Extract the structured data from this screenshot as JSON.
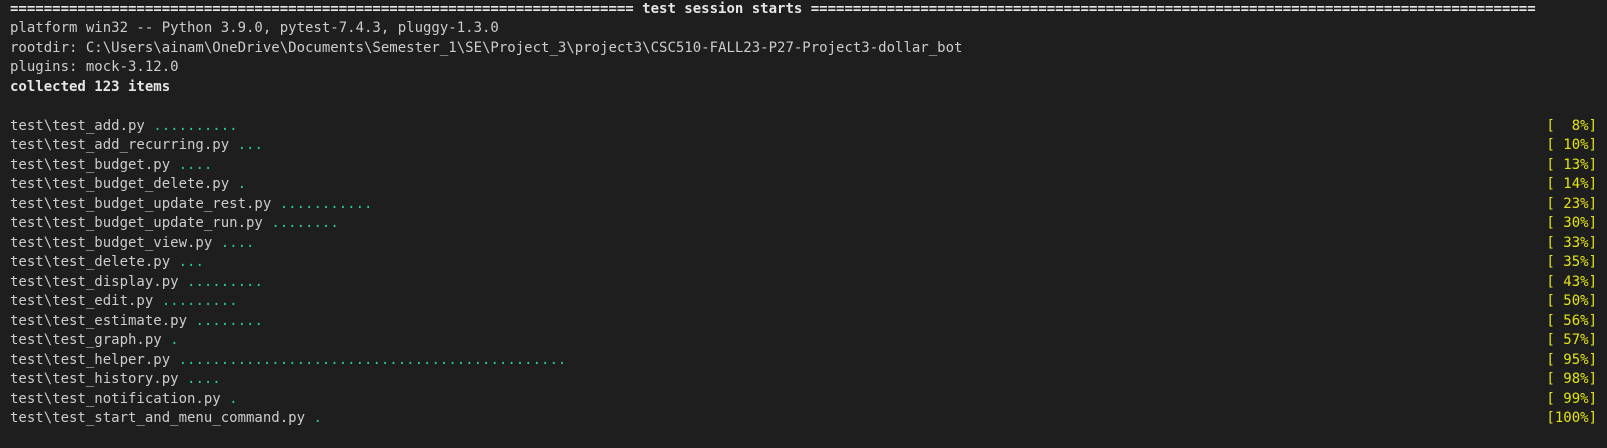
{
  "header": {
    "separator_left": "==========================================================================",
    "title": " test session starts ",
    "separator_right": "======================================================================================"
  },
  "session_info": {
    "platform": "platform win32 -- Python 3.9.0, pytest-7.4.3, pluggy-1.3.0",
    "rootdir": "rootdir: C:\\Users\\ainam\\OneDrive\\Documents\\Semester_1\\SE\\Project_3\\project3\\CSC510-FALL23-P27-Project3-dollar_bot",
    "plugins": "plugins: mock-3.12.0",
    "collected": "collected 123 items"
  },
  "tests": [
    {
      "file": "test\\test_add.py",
      "dots": "..........",
      "progress": "[  8%]"
    },
    {
      "file": "test\\test_add_recurring.py",
      "dots": "...",
      "progress": "[ 10%]"
    },
    {
      "file": "test\\test_budget.py",
      "dots": "....",
      "progress": "[ 13%]"
    },
    {
      "file": "test\\test_budget_delete.py",
      "dots": ".",
      "progress": "[ 14%]"
    },
    {
      "file": "test\\test_budget_update_rest.py",
      "dots": "...........",
      "progress": "[ 23%]"
    },
    {
      "file": "test\\test_budget_update_run.py",
      "dots": "........",
      "progress": "[ 30%]"
    },
    {
      "file": "test\\test_budget_view.py",
      "dots": "....",
      "progress": "[ 33%]"
    },
    {
      "file": "test\\test_delete.py",
      "dots": "...",
      "progress": "[ 35%]"
    },
    {
      "file": "test\\test_display.py",
      "dots": ".........",
      "progress": "[ 43%]"
    },
    {
      "file": "test\\test_edit.py",
      "dots": ".........",
      "progress": "[ 50%]"
    },
    {
      "file": "test\\test_estimate.py",
      "dots": "........",
      "progress": "[ 56%]"
    },
    {
      "file": "test\\test_graph.py",
      "dots": ".",
      "progress": "[ 57%]"
    },
    {
      "file": "test\\test_helper.py",
      "dots": "..............................................",
      "progress": "[ 95%]"
    },
    {
      "file": "test\\test_history.py",
      "dots": "....",
      "progress": "[ 98%]"
    },
    {
      "file": "test\\test_notification.py",
      "dots": ".",
      "progress": "[ 99%]"
    },
    {
      "file": "test\\test_start_and_menu_command.py",
      "dots": ".",
      "progress": "[100%]"
    }
  ],
  "colors": {
    "background": "#1e1e1e",
    "text": "#cccccc",
    "pass_dots": "#23d18b",
    "progress": "#e5e510"
  }
}
